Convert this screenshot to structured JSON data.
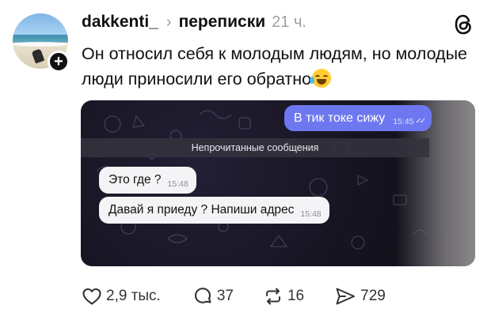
{
  "post": {
    "author": "dakkenti_",
    "community": "переписки",
    "time": "21 ч.",
    "text": "Он относил себя к молодым людям, но молодые люди приносили его обратно",
    "text_emoji": "face-with-tears-of-joy-icon"
  },
  "chat": {
    "outgoing": {
      "text": "В тик токе сижу",
      "time": "15:45"
    },
    "unread_label": "Непрочитанные сообщения",
    "incoming": [
      {
        "text": "Это где ?",
        "time": "15:48"
      },
      {
        "text": "Давай я приеду ? Напиши адрес",
        "time": "15:48"
      }
    ]
  },
  "actions": {
    "likes": "2,9 тыс.",
    "comments": "37",
    "reposts": "16",
    "shares": "729"
  },
  "colors": {
    "outgoing_bubble": "#6d78f0",
    "chat_background": "#15131f",
    "text": "#111111"
  },
  "icons": [
    "plus-icon",
    "chevron-right-icon",
    "threads-logo-icon",
    "heart-icon",
    "comment-icon",
    "repost-icon",
    "share-icon"
  ]
}
